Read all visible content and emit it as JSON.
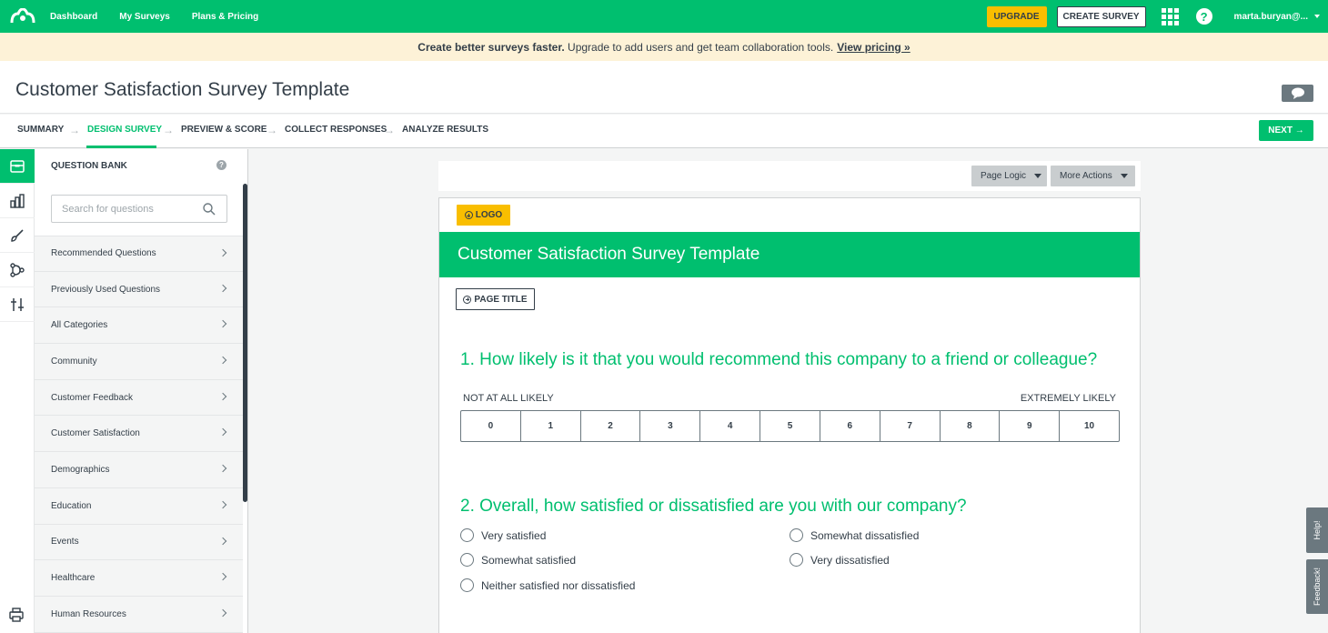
{
  "topnav": {
    "links": [
      "Dashboard",
      "My Surveys",
      "Plans & Pricing"
    ],
    "upgrade_label": "UPGRADE",
    "create_label": "CREATE SURVEY",
    "help_glyph": "?",
    "user_label": "marta.buryan@..."
  },
  "banner": {
    "bold_text": "Create better surveys faster.",
    "text": " Upgrade to add users and get team collaboration tools.",
    "link_text": "View pricing »"
  },
  "page": {
    "title": "Customer Satisfaction Survey Template"
  },
  "steps": {
    "items": [
      "SUMMARY",
      "DESIGN SURVEY",
      "PREVIEW & SCORE",
      "COLLECT RESPONSES",
      "ANALYZE RESULTS"
    ],
    "active": "DESIGN SURVEY",
    "arrow": "→",
    "next_label": "NEXT →"
  },
  "rail": {
    "icons": [
      "question-bank-icon",
      "themes-icon",
      "style-icon",
      "logic-icon",
      "options-icon",
      "print-icon"
    ]
  },
  "question_bank": {
    "title": "QUESTION BANK",
    "help_glyph": "?",
    "search_placeholder": "Search for questions",
    "categories": [
      "Recommended Questions",
      "Previously Used Questions",
      "All Categories",
      "Community",
      "Customer Feedback",
      "Customer Satisfaction",
      "Demographics",
      "Education",
      "Events",
      "Healthcare",
      "Human Resources"
    ]
  },
  "survey": {
    "page_logic_label": "Page Logic",
    "more_actions_label": "More Actions",
    "logo_label": "LOGO",
    "banner_title": "Customer Satisfaction Survey Template",
    "page_title_label": "PAGE TITLE",
    "q1": {
      "text": "1. How likely is it that you would recommend this company to a friend or colleague?",
      "low_label": "NOT AT ALL LIKELY",
      "high_label": "EXTREMELY LIKELY",
      "scale": [
        "0",
        "1",
        "2",
        "3",
        "4",
        "5",
        "6",
        "7",
        "8",
        "9",
        "10"
      ]
    },
    "q2": {
      "text": "2. Overall, how satisfied or dissatisfied are you with our company?",
      "options": [
        "Very satisfied",
        "Somewhat satisfied",
        "Neither satisfied nor dissatisfied",
        "Somewhat dissatisfied",
        "Very dissatisfied"
      ]
    }
  },
  "side_tabs": {
    "help": "Help!",
    "feedback": "Feedback!"
  },
  "colors": {
    "brand_green": "#00bf6f",
    "upgrade_yellow": "#f9be00",
    "banner_bg": "#fdf2d7",
    "text_dark": "#333e48"
  }
}
